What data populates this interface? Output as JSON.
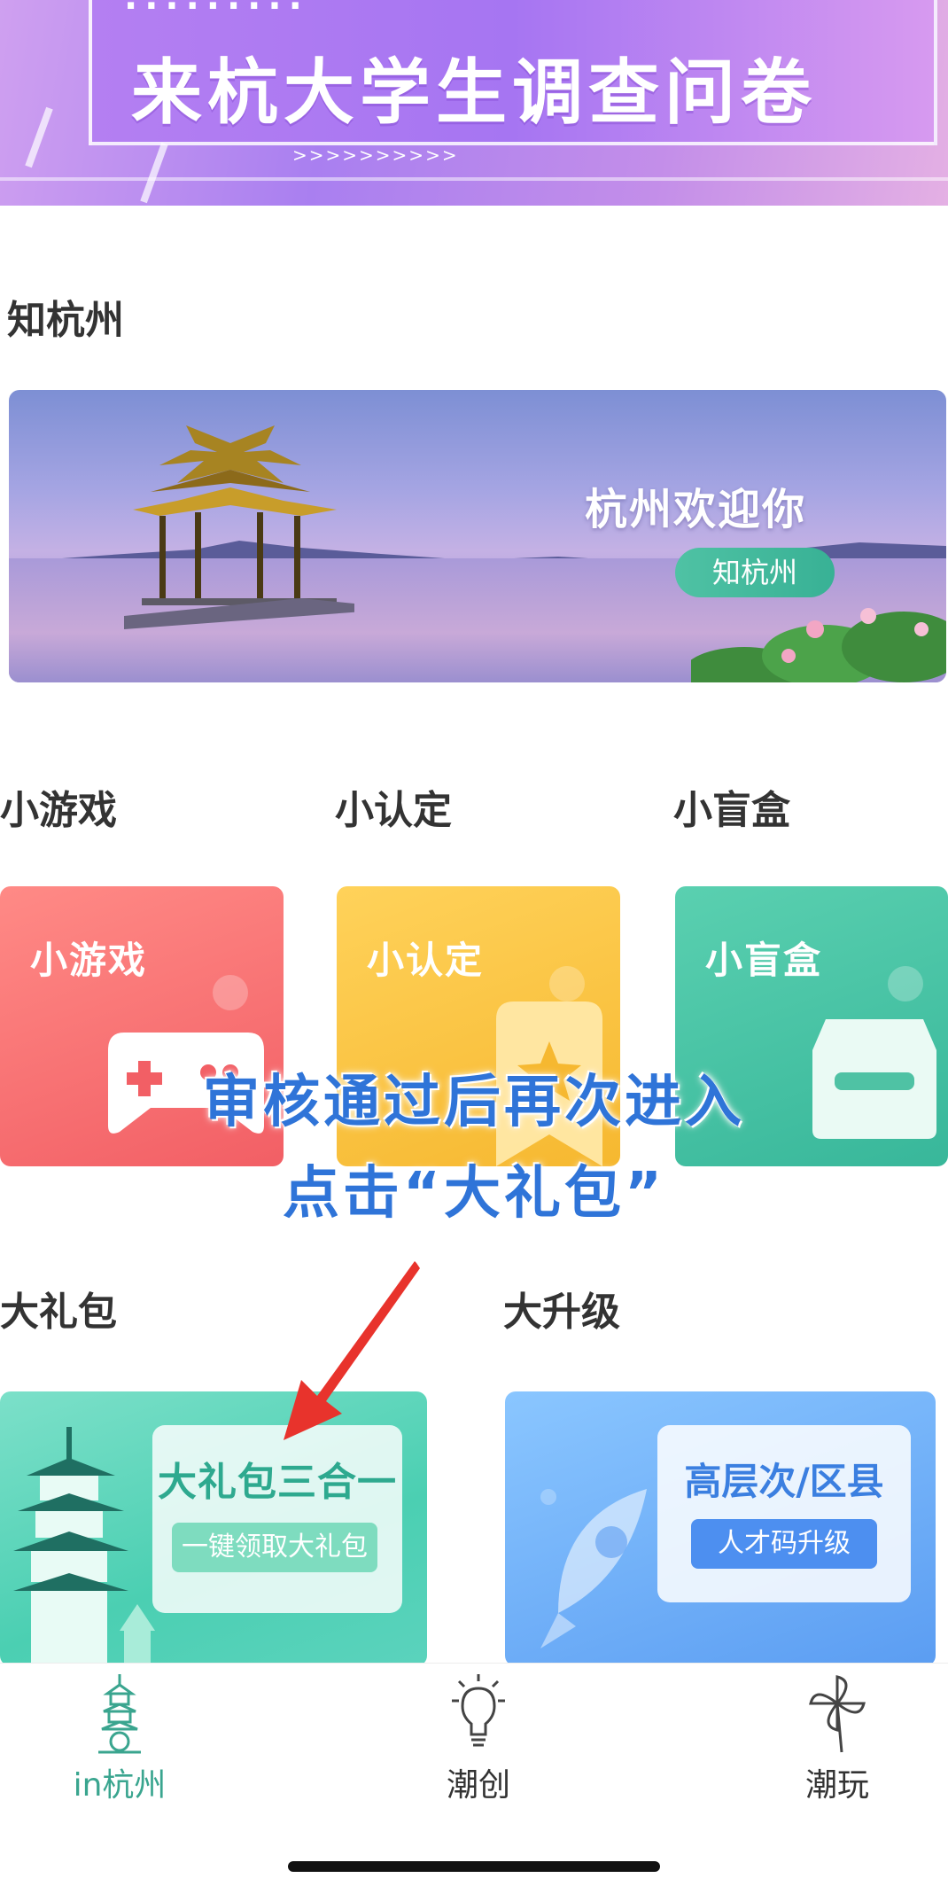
{
  "top_banner": {
    "title": "来杭大学生调查问卷",
    "top_text": "·········",
    "chevrons": ">>>>>>>>>>"
  },
  "sections": {
    "zhi_hangzhou": "知杭州",
    "mini_game": "小游戏",
    "mini_cert": "小认定",
    "mini_box": "小盲盒",
    "big_gift": "大礼包",
    "big_upgrade": "大升级"
  },
  "hz_banner": {
    "welcome": "杭州欢迎你",
    "pill": "知杭州"
  },
  "cards": {
    "game_label": "小游戏",
    "cert_label": "小认定",
    "box_label": "小盲盒",
    "gift_title": "大礼包三合一",
    "gift_button": "一键领取大礼包",
    "upgrade_title": "高层次/区县",
    "upgrade_button": "人才码升级"
  },
  "annotation": {
    "line1": "审核通过后再次进入",
    "line2": "点击“大礼包”"
  },
  "tabbar": {
    "items": [
      {
        "label": "in杭州",
        "icon": "pagoda-icon",
        "active": true
      },
      {
        "label": "潮创",
        "icon": "lightbulb-icon",
        "active": false
      },
      {
        "label": "潮玩",
        "icon": "pinwheel-icon",
        "active": false
      }
    ]
  },
  "colors": {
    "accent_green": "#3aa58f",
    "annotation_blue": "#2f74d8",
    "arrow_red": "#e8332c"
  }
}
